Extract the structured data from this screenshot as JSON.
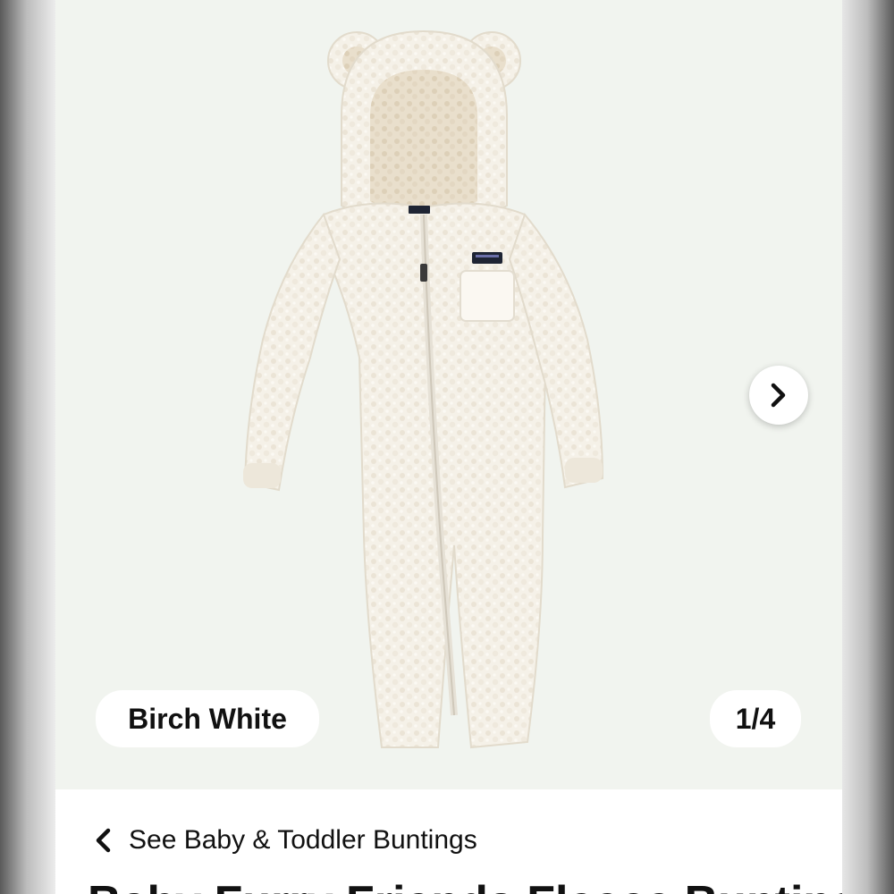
{
  "gallery": {
    "color_name": "Birch White",
    "image_counter": "1/4",
    "next_icon": "chevron-right-icon",
    "background_color": "#f1f4ef"
  },
  "nav": {
    "back_label": "See Baby & Toddler Buntings",
    "back_icon": "chevron-left-icon"
  },
  "product": {
    "title": "Baby Furry Friends Fleece Bunting"
  }
}
